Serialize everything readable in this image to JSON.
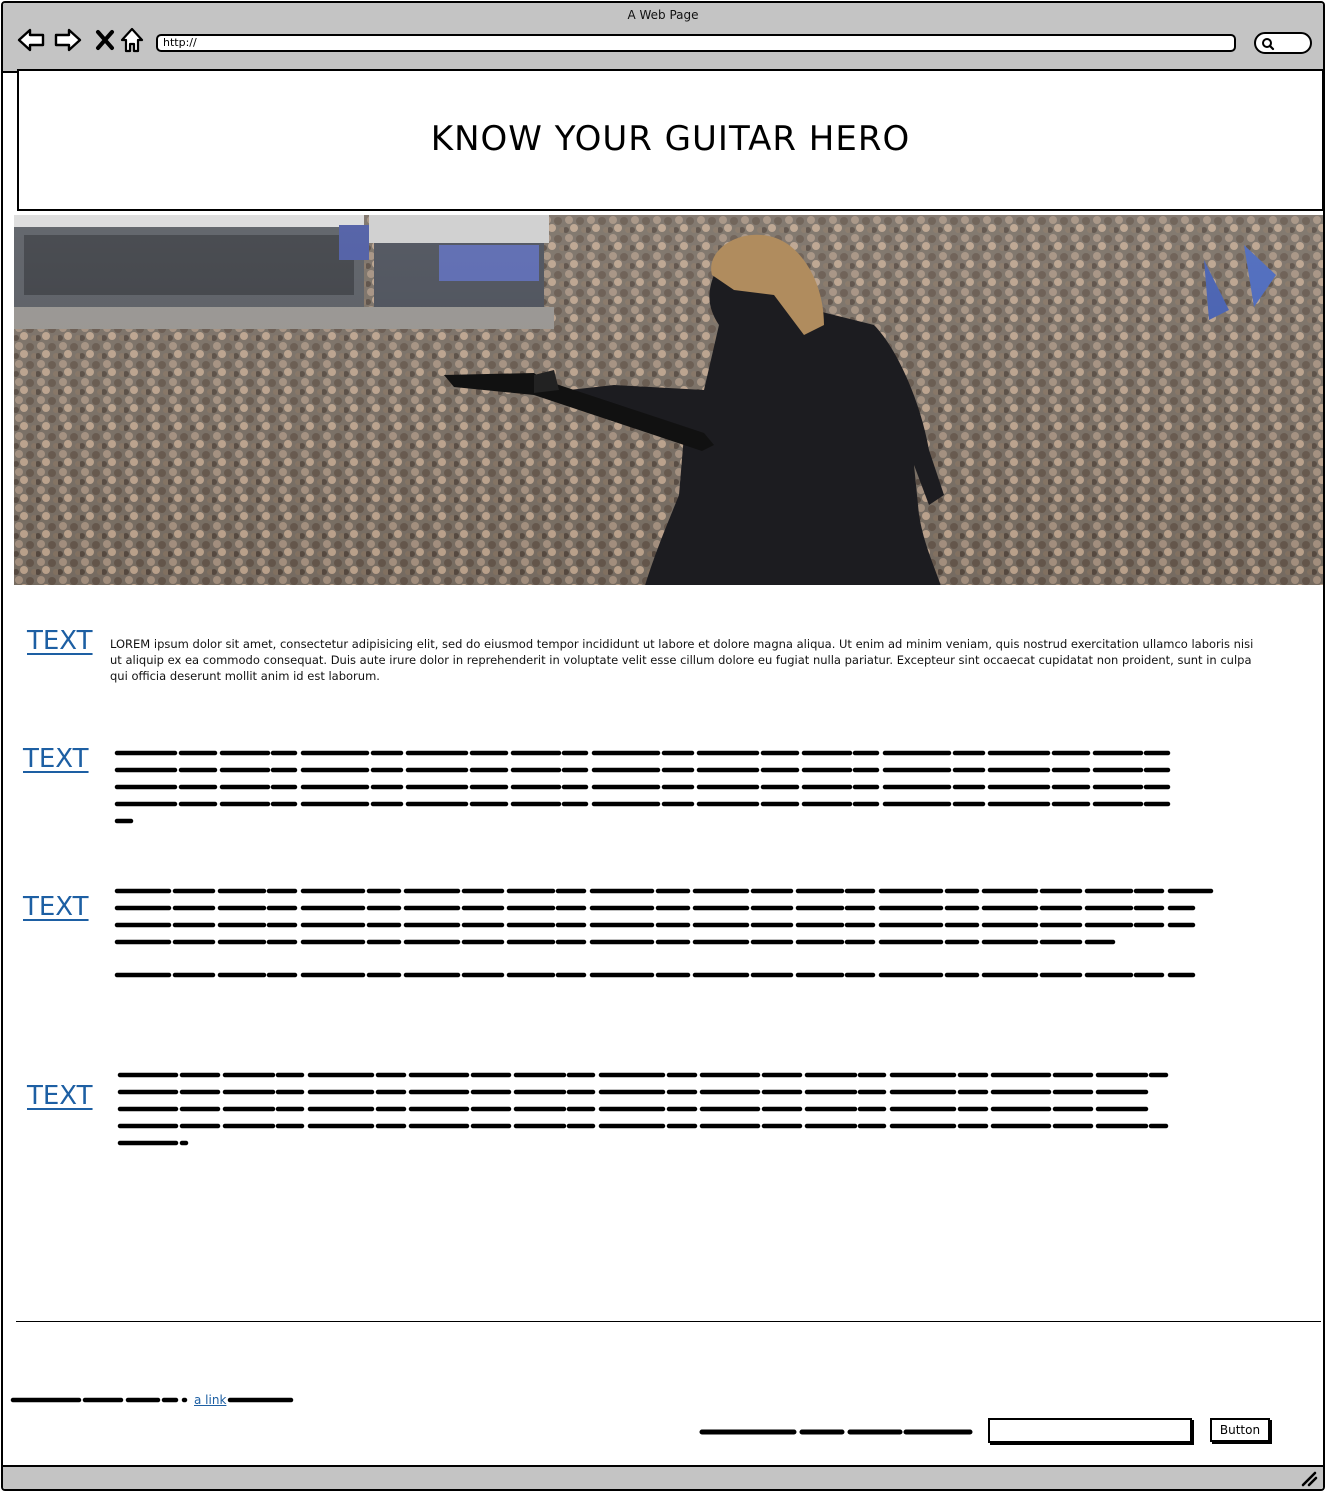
{
  "window": {
    "title": "A Web Page"
  },
  "toolbar": {
    "url": "http://"
  },
  "header": {
    "title": "KNOW YOUR GUITAR HERO"
  },
  "hero": {
    "image_icon": "concert-photo"
  },
  "sections": [
    {
      "title": "TEXT",
      "body": "LOREM ipsum dolor sit amet, consectetur adipisicing elit, sed do eiusmod tempor incididunt ut labore et dolore magna aliqua. Ut enim ad minim veniam, quis nostrud exercitation ullamco laboris nisi ut aliquip ex ea commodo consequat. Duis aute irure dolor in reprehenderit in voluptate velit esse cillum dolore eu fugiat nulla pariatur. Excepteur sint occaecat cupidatat non proident, sunt in culpa qui officia deserunt mollit anim id est laborum."
    },
    {
      "title": "TEXT"
    },
    {
      "title": "TEXT"
    },
    {
      "title": "TEXT"
    }
  ],
  "footer": {
    "link_label": "a link",
    "button_label": "Button"
  },
  "colors": {
    "chrome": "#c4c4c4",
    "link": "#1d5fa3"
  }
}
